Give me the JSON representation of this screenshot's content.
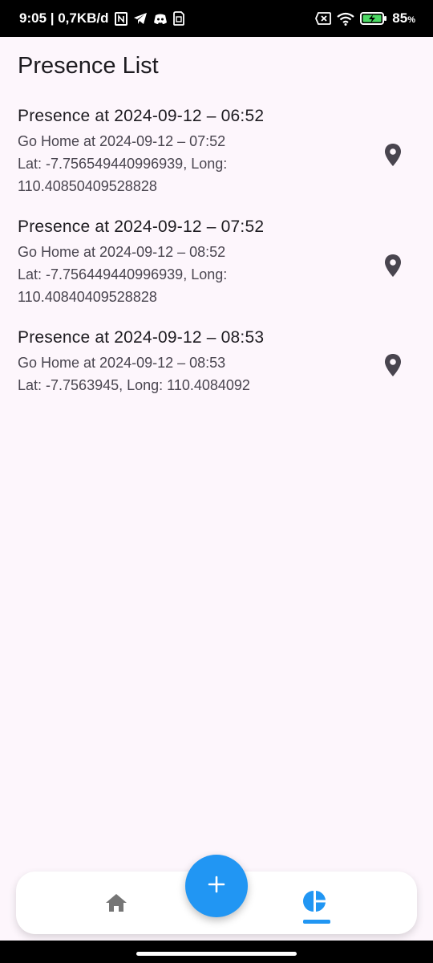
{
  "status_bar": {
    "time_and_speed": "9:05 | 0,7KB/d",
    "battery_percent": "85",
    "battery_unit": "%",
    "icons": [
      "nfc-icon",
      "telegram-icon",
      "discord-icon",
      "sim-icon",
      "sim-blocked-icon",
      "wifi-icon",
      "battery-charging-icon"
    ]
  },
  "page": {
    "title": "Presence List"
  },
  "presences": [
    {
      "title": "Presence at 2024-09-12 – 06:52",
      "go_home": "Go Home at 2024-09-12 – 07:52",
      "coords_line1": "Lat: -7.756549440996939, Long:",
      "coords_line2": "110.40850409528828"
    },
    {
      "title": "Presence at 2024-09-12 – 07:52",
      "go_home": "Go Home at 2024-09-12 – 08:52",
      "coords_line1": "Lat: -7.756449440996939, Long:",
      "coords_line2": "110.40840409528828"
    },
    {
      "title": "Presence at 2024-09-12 – 08:53",
      "go_home": "Go Home at 2024-09-12 – 08:53",
      "coords_line1": "Lat: -7.7563945, Long: 110.4084092",
      "coords_line2": ""
    }
  ],
  "bottom_nav": {
    "items": [
      {
        "icon": "home-icon",
        "selected": false
      },
      {
        "icon": "pie-chart-icon",
        "selected": true
      }
    ],
    "fab_icon": "plus-icon"
  },
  "colors": {
    "accent": "#2196f3",
    "background": "#fdf6fc",
    "text_primary": "#1d1b20",
    "text_secondary": "#49454f",
    "icon_dark": "#49454f",
    "nav_inactive": "#757575"
  }
}
